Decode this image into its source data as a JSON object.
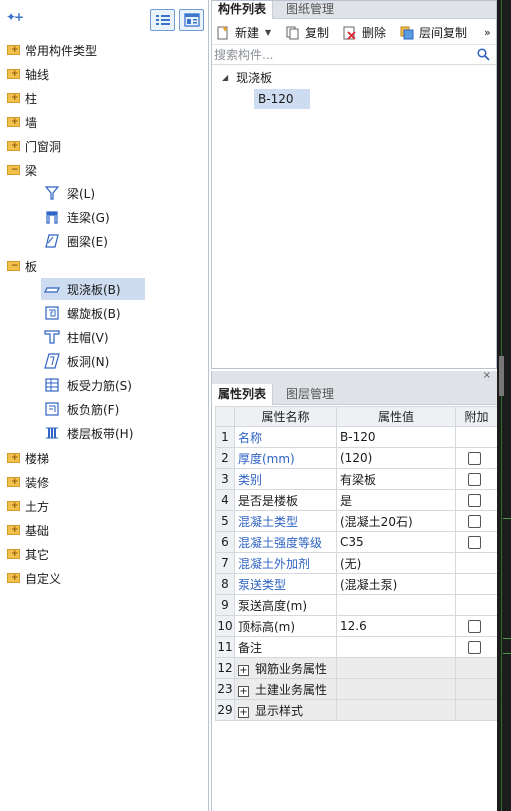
{
  "left_panel": {
    "tree": [
      {
        "label": "常用构件类型"
      },
      {
        "label": "轴线"
      },
      {
        "label": "柱"
      },
      {
        "label": "墙"
      },
      {
        "label": "门窗洞"
      },
      {
        "label": "梁",
        "expanded": true,
        "children": [
          {
            "label": "梁(L)",
            "icon": "beam-icon"
          },
          {
            "label": "连梁(G)",
            "icon": "link-beam-icon"
          },
          {
            "label": "圈梁(E)",
            "icon": "ring-beam-icon"
          }
        ]
      },
      {
        "label": "板",
        "expanded": true,
        "children": [
          {
            "label": "现浇板(B)",
            "icon": "cast-slab-icon",
            "selected": true
          },
          {
            "label": "螺旋板(B)",
            "icon": "spiral-slab-icon"
          },
          {
            "label": "柱帽(V)",
            "icon": "column-cap-icon"
          },
          {
            "label": "板洞(N)",
            "icon": "slab-hole-icon"
          },
          {
            "label": "板受力筋(S)",
            "icon": "slab-rebar-icon"
          },
          {
            "label": "板负筋(F)",
            "icon": "negative-rebar-icon"
          },
          {
            "label": "楼层板带(H)",
            "icon": "floor-strip-icon"
          }
        ]
      },
      {
        "label": "楼梯"
      },
      {
        "label": "装修"
      },
      {
        "label": "土方"
      },
      {
        "label": "基础"
      },
      {
        "label": "其它"
      },
      {
        "label": "自定义"
      }
    ]
  },
  "component_panel": {
    "tabs": [
      "构件列表",
      "图纸管理"
    ],
    "toolbar": {
      "new": "新建",
      "copy": "复制",
      "delete": "删除",
      "floor_copy": "层间复制",
      "more": "»"
    },
    "search_placeholder": "搜索构件...",
    "tree_root": "现浇板",
    "tree_child": "B-120"
  },
  "attribute_panel": {
    "tabs": [
      "属性列表",
      "图层管理"
    ],
    "close": "×",
    "headers": {
      "name": "属性名称",
      "value": "属性值",
      "extra": "附加"
    },
    "rows": [
      {
        "num": "1",
        "name": "名称",
        "value": "B-120",
        "blue": true,
        "check": false
      },
      {
        "num": "2",
        "name": "厚度(mm)",
        "value": "(120)",
        "blue": true,
        "check": true
      },
      {
        "num": "3",
        "name": "类别",
        "value": "有梁板",
        "blue": true,
        "check": true
      },
      {
        "num": "4",
        "name": "是否是楼板",
        "value": "是",
        "blue": false,
        "check": true
      },
      {
        "num": "5",
        "name": "混凝土类型",
        "value": "(混凝土20石)",
        "blue": true,
        "check": true
      },
      {
        "num": "6",
        "name": "混凝土强度等级",
        "value": "C35",
        "blue": true,
        "check": true
      },
      {
        "num": "7",
        "name": "混凝土外加剂",
        "value": "(无)",
        "blue": true,
        "check": false
      },
      {
        "num": "8",
        "name": "泵送类型",
        "value": "(混凝土泵)",
        "blue": true,
        "check": false
      },
      {
        "num": "9",
        "name": "泵送高度(m)",
        "value": "",
        "blue": false,
        "check": false
      },
      {
        "num": "10",
        "name": "顶标高(m)",
        "value": "12.6",
        "blue": false,
        "check": true
      },
      {
        "num": "11",
        "name": "备注",
        "value": "",
        "blue": false,
        "check": true
      },
      {
        "num": "12",
        "name": "钢筋业务属性",
        "value": "",
        "blue": false,
        "group": true
      },
      {
        "num": "23",
        "name": "土建业务属性",
        "value": "",
        "blue": false,
        "group": true
      },
      {
        "num": "29",
        "name": "显示样式",
        "value": "",
        "blue": false,
        "group": true
      }
    ]
  },
  "colors": {
    "accent": "#2f63c4",
    "selection": "#cddcf0",
    "folder": "#f2c04b",
    "tab_bg": "#dfe3e8"
  }
}
